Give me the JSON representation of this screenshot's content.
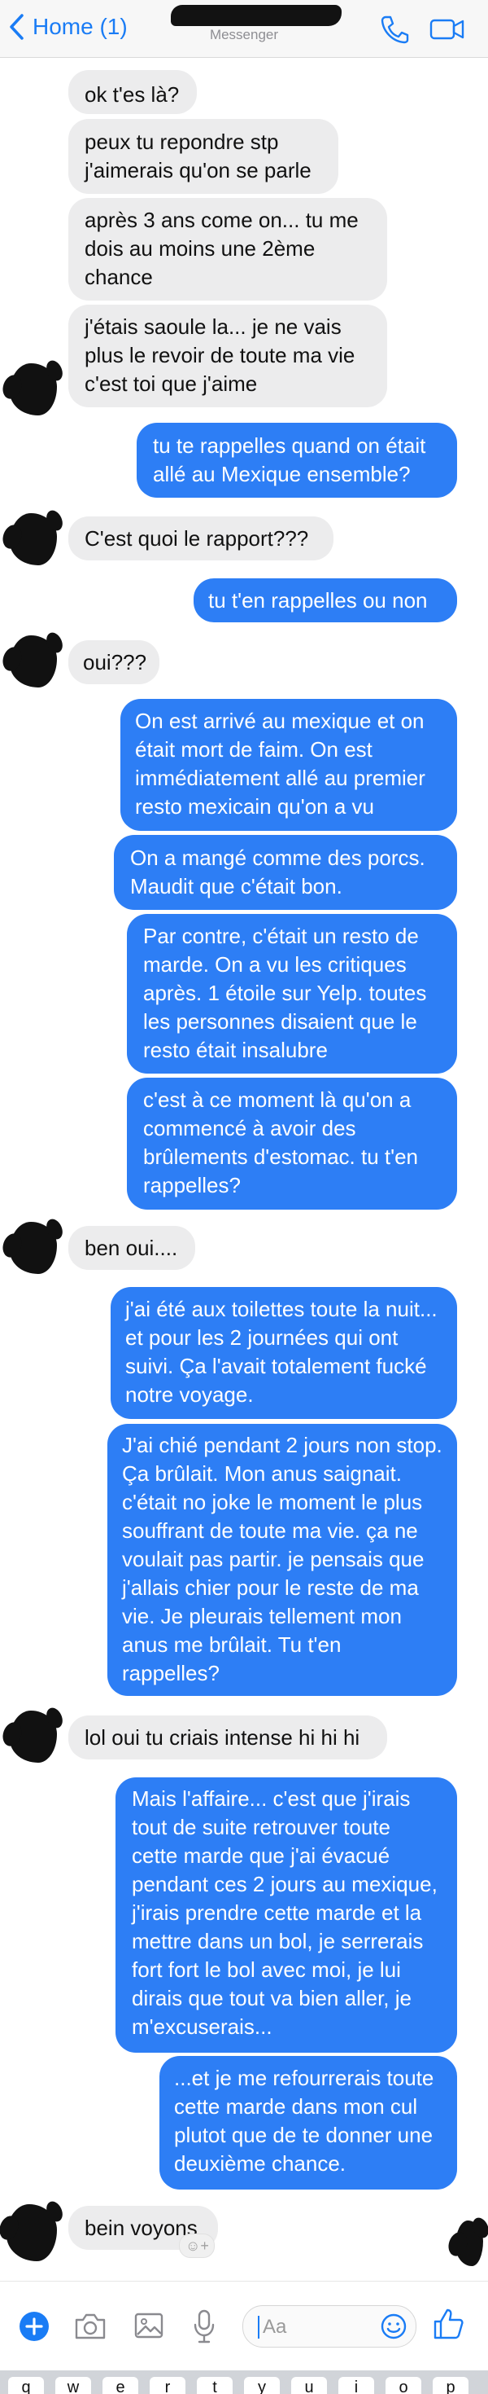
{
  "header": {
    "back_label": "Home (1)",
    "subtitle": "Messenger"
  },
  "messages": [
    {
      "dir": "in",
      "text": "ok t'es là?"
    },
    {
      "dir": "in",
      "text": "peux tu repondre stp j'aimerais qu'on se parle"
    },
    {
      "dir": "in",
      "text": "après 3 ans come on... tu me dois au moins une 2ème chance"
    },
    {
      "dir": "in",
      "text": "j'étais saoule la... je ne vais plus le revoir de toute ma vie c'est toi que j'aime"
    },
    {
      "dir": "out",
      "text": "tu te rappelles quand on était allé au Mexique ensemble?"
    },
    {
      "dir": "in",
      "text": "C'est quoi le rapport???"
    },
    {
      "dir": "out",
      "text": "tu t'en rappelles ou non"
    },
    {
      "dir": "in",
      "text": "oui???"
    },
    {
      "dir": "out",
      "text": "On est arrivé au mexique et on était mort de faim. On est immédiatement allé au premier resto mexicain qu'on a vu"
    },
    {
      "dir": "out",
      "text": "On a mangé comme des porcs. Maudit que c'était bon."
    },
    {
      "dir": "out",
      "text": "Par contre, c'était un resto de marde. On a vu les critiques après. 1 étoile sur Yelp. toutes les personnes disaient que le resto était insalubre"
    },
    {
      "dir": "out",
      "text": "c'est à ce moment là qu'on a commencé à avoir des brûlements d'estomac. tu t'en rappelles?"
    },
    {
      "dir": "in",
      "text": "ben oui...."
    },
    {
      "dir": "out",
      "text": "j'ai été aux toilettes toute la nuit... et pour les 2 journées qui ont suivi. Ça l'avait totalement fucké notre voyage."
    },
    {
      "dir": "out",
      "text": "J'ai chié pendant 2 jours non stop. Ça brûlait. Mon anus saignait. c'était no joke le moment le plus souffrant de toute ma vie. ça ne voulait pas partir.  je pensais que j'allais chier pour le reste de ma vie. Je pleurais tellement mon anus me brûlait. Tu t'en rappelles?"
    },
    {
      "dir": "in",
      "text": "lol oui tu criais intense hi hi hi"
    },
    {
      "dir": "out",
      "text": "Mais l'affaire... c'est que j'irais tout de suite retrouver toute cette marde que j'ai évacué pendant ces 2 jours au mexique, j'irais prendre cette marde et la mettre dans un bol, je serrerais fort fort le bol avec moi, je lui dirais que tout va bien aller, je m'excuserais..."
    },
    {
      "dir": "out",
      "text": "...et je me refourrerais toute cette marde dans mon cul plutot que de te donner une deuxième chance."
    },
    {
      "dir": "in",
      "text": "bein voyons"
    }
  ],
  "composer": {
    "placeholder": "Aa"
  },
  "keyboard": {
    "keys": [
      "q",
      "w",
      "e",
      "r",
      "t",
      "y",
      "u",
      "i",
      "o",
      "p"
    ]
  },
  "colors": {
    "accent": "#1a7cf5",
    "outgoing_bubble": "#2d7ef5",
    "incoming_bubble": "#ececed"
  },
  "icons": [
    "chevron-left-icon",
    "phone-icon",
    "video-camera-icon",
    "plus-icon",
    "camera-icon",
    "gallery-icon",
    "microphone-icon",
    "emoji-icon",
    "thumbs-up-icon",
    "reaction-smiley-icon"
  ]
}
